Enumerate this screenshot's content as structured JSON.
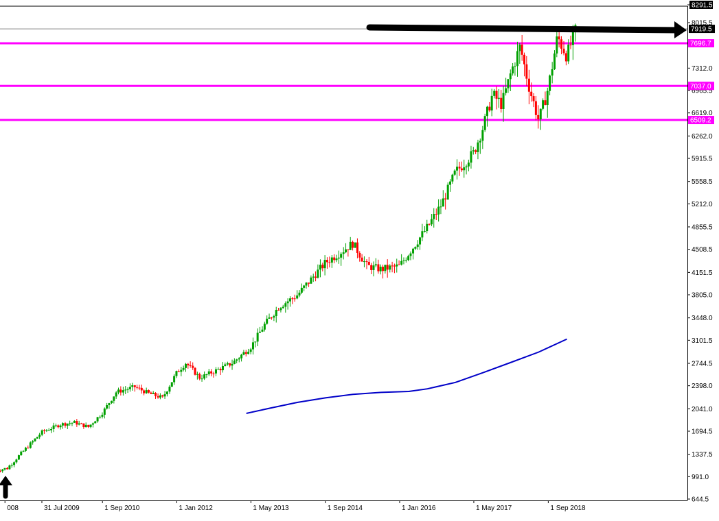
{
  "chart_data": {
    "type": "candlestick",
    "title": "",
    "xlabel": "",
    "ylabel": "",
    "ylim": [
      644.5,
      8291.5
    ],
    "x_range": [
      "2008-09-01",
      "2021-03-01"
    ],
    "y_ticks": [
      8291.5,
      8015.5,
      7312.0,
      6965.5,
      6619.0,
      6262.0,
      5915.5,
      5558.5,
      5212.0,
      4855.5,
      4508.5,
      4151.5,
      3805.0,
      3448.0,
      3101.5,
      2744.5,
      2398.0,
      2041.0,
      1694.5,
      1337.5,
      991.0,
      644.5
    ],
    "x_ticks": [
      {
        "date": "2008-12-01",
        "label": "008"
      },
      {
        "date": "2009-07-31",
        "label": "31 Jul 2009"
      },
      {
        "date": "2010-09-01",
        "label": "1 Sep 2010"
      },
      {
        "date": "2012-01-01",
        "label": "1 Jan 2012"
      },
      {
        "date": "2013-05-01",
        "label": "1 May 2013"
      },
      {
        "date": "2014-09-01",
        "label": "1 Sep 2014"
      },
      {
        "date": "2016-01-01",
        "label": "1 Jan 2016"
      },
      {
        "date": "2017-05-01",
        "label": "1 May 2017"
      },
      {
        "date": "2018-09-01",
        "label": "1 Sep 2018"
      }
    ],
    "current_price": {
      "value": 7919.5,
      "label": "7919.5"
    },
    "levels": [
      {
        "value": 7696.7,
        "label": "7696.7",
        "color": "#ff00ff"
      },
      {
        "value": 7037.0,
        "label": "7037.0",
        "color": "#ff00ff"
      },
      {
        "value": 6509.2,
        "label": "6509.2",
        "color": "#ff00ff"
      }
    ],
    "colors": {
      "up": "#00a000",
      "down": "#ff0000",
      "level": "#ff00ff",
      "ma": "#0000c8",
      "price_line": "#808080",
      "annotation": "#000000"
    },
    "moving_average": {
      "name": "",
      "points": [
        [
          "2013-04-01",
          1970
        ],
        [
          "2013-09-01",
          2050
        ],
        [
          "2014-03-01",
          2140
        ],
        [
          "2014-09-01",
          2210
        ],
        [
          "2015-03-01",
          2265
        ],
        [
          "2015-09-01",
          2295
        ],
        [
          "2016-03-01",
          2310
        ],
        [
          "2016-07-01",
          2350
        ],
        [
          "2017-01-01",
          2450
        ],
        [
          "2017-07-01",
          2600
        ],
        [
          "2018-01-01",
          2760
        ],
        [
          "2018-07-01",
          2920
        ],
        [
          "2019-01-01",
          3120
        ]
      ]
    },
    "anchors": [
      [
        "2008-10-01",
        1090
      ],
      [
        "2008-12-15",
        1120
      ],
      [
        "2009-03-01",
        1310
      ],
      [
        "2009-07-31",
        1680
      ],
      [
        "2009-12-01",
        1800
      ],
      [
        "2010-03-01",
        1830
      ],
      [
        "2010-06-01",
        1760
      ],
      [
        "2010-09-01",
        1980
      ],
      [
        "2010-12-01",
        2300
      ],
      [
        "2011-04-01",
        2380
      ],
      [
        "2011-07-01",
        2280
      ],
      [
        "2011-10-01",
        2210
      ],
      [
        "2012-01-01",
        2600
      ],
      [
        "2012-03-01",
        2750
      ],
      [
        "2012-06-01",
        2520
      ],
      [
        "2012-09-01",
        2620
      ],
      [
        "2013-01-01",
        2750
      ],
      [
        "2013-05-01",
        3000
      ],
      [
        "2013-08-01",
        3350
      ],
      [
        "2013-11-01",
        3620
      ],
      [
        "2014-03-01",
        3800
      ],
      [
        "2014-06-01",
        4050
      ],
      [
        "2014-09-01",
        4300
      ],
      [
        "2014-12-01",
        4450
      ],
      [
        "2015-03-01",
        4600
      ],
      [
        "2015-06-01",
        4250
      ],
      [
        "2015-09-01",
        4200
      ],
      [
        "2016-01-01",
        4250
      ],
      [
        "2016-04-01",
        4550
      ],
      [
        "2016-07-01",
        4850
      ],
      [
        "2016-10-01",
        5200
      ],
      [
        "2017-01-01",
        5700
      ],
      [
        "2017-05-01",
        6000
      ],
      [
        "2017-07-01",
        6400
      ],
      [
        "2017-09-01",
        6900
      ],
      [
        "2017-11-01",
        6750
      ],
      [
        "2018-01-01",
        7250
      ],
      [
        "2018-03-01",
        7650
      ],
      [
        "2018-05-01",
        7000
      ],
      [
        "2018-07-01",
        6500
      ],
      [
        "2018-09-01",
        7000
      ],
      [
        "2018-11-01",
        7800
      ],
      [
        "2019-01-01",
        7500
      ],
      [
        "2019-03-01",
        7900
      ]
    ]
  }
}
